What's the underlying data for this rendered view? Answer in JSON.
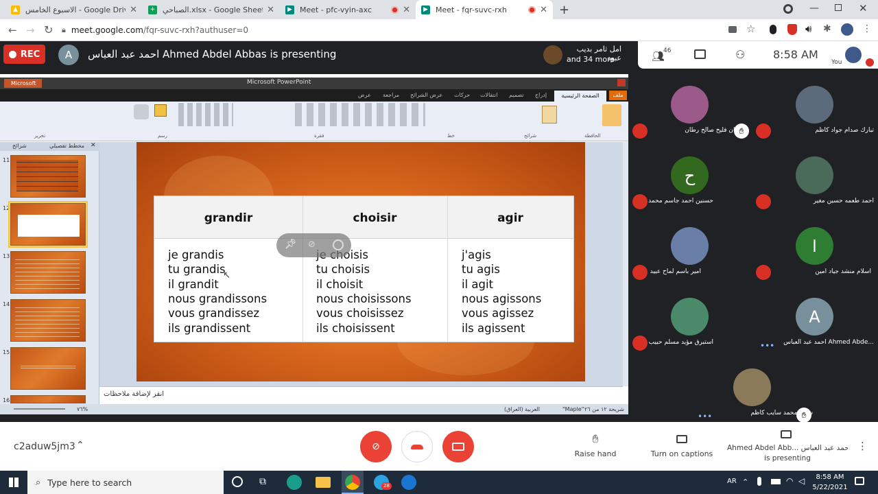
{
  "browser": {
    "tabs": [
      {
        "title": "الاسبوع الخامس - Google Drive",
        "color": "#fbbc04"
      },
      {
        "title": "الصباحي.xlsx - Google Sheets",
        "color": "#0f9d58"
      },
      {
        "title": "Meet - pfc-vyin-axc",
        "color": "#00897b"
      },
      {
        "title": "Meet - fqr-suvc-rxh",
        "color": "#00897b"
      }
    ],
    "new_tab": "+",
    "url_domain": "meet.google.com",
    "url_path": "/fqr-suvc-rxh?authuser=0"
  },
  "meet_top": {
    "rec_label": "REC",
    "presenter_avatar_letter": "A",
    "presenting_text": "احمد عبد العباس Ahmed Abdel Abbas is presenting",
    "others_name": "امل ثامر بديب عبود",
    "others_more": "and 34 more",
    "participant_count": "46",
    "time": "8:58 AM",
    "you_label": "You"
  },
  "powerpoint": {
    "app_title": "Microsoft PowerPoint",
    "window_label": "Microsoft Po",
    "ribbon_tabs": [
      "ملف",
      "الصفحة الرئيسية",
      "إدراج",
      "تصميم",
      "انتقالات",
      "حركات",
      "عرض الشرائح",
      "مراجعة",
      "عرض"
    ],
    "group_labels": [
      "الحافظة",
      "شرائح",
      "خط",
      "فقرة",
      "رسم",
      "تحرير"
    ],
    "panel_tabs": [
      "شرائح",
      "مخطط تفصيلي"
    ],
    "thumb_numbers": [
      "11",
      "12",
      "13",
      "14",
      "15",
      "16"
    ],
    "notes_placeholder": "انقر لإضافة ملاحظات",
    "status_slide": "شريحة ١٢ من ٢٦",
    "status_theme": "\"Maple\"",
    "status_lang": "العربية (العراق)",
    "status_zoom": "٧٦%"
  },
  "slide": {
    "columns": [
      {
        "verb": "grandir",
        "forms": [
          "je grandis",
          "tu grandis",
          "il grandit",
          "nous grandissons",
          "vous grandissez",
          "ils grandissent"
        ]
      },
      {
        "verb": "choisir",
        "forms": [
          "je choisis",
          "tu choisis",
          "il choisit",
          "nous choisissons",
          "vous choisissez",
          "ils choisissent"
        ]
      },
      {
        "verb": "agir",
        "forms": [
          "j'agis",
          "tu agis",
          "il agit",
          "nous agissons",
          "vous agissez",
          "ils agissent"
        ]
      }
    ]
  },
  "participants": [
    {
      "name": "تبارك صدام جواد كاظم",
      "muted": true,
      "avatar": "photo",
      "color": "#5b6b7b"
    },
    {
      "name": "ايمان فليح صالح رطان",
      "muted": true,
      "avatar": "photo",
      "color": "#9b5a8a",
      "hand": true
    },
    {
      "name": "احمد طعمه حسين مغير",
      "muted": true,
      "avatar": "photo",
      "color": "#4a6a5a"
    },
    {
      "name": "حسنين احمد جاسم محمد",
      "muted": true,
      "avatar": "letter",
      "letter": "ح",
      "color": "#33691e"
    },
    {
      "name": "اسلام منشد جياد امين",
      "muted": true,
      "avatar": "letter",
      "letter": "ا",
      "color": "#2e7d32"
    },
    {
      "name": "امير باسم لماح عبيد",
      "muted": true,
      "avatar": "photo",
      "color": "#6a7fa8"
    },
    {
      "name": "احمد عبد العباس Ahmed Abde...",
      "muted": false,
      "avatar": "letter",
      "letter": "A",
      "color": "#78909c"
    },
    {
      "name": "استبرق مؤيد مسلم حبيب",
      "muted": true,
      "avatar": "photo",
      "color": "#4a8a6a"
    },
    {
      "name": "سدير محمد سايب كاظم",
      "muted": false,
      "avatar": "photo",
      "color": "#8a7a5a",
      "hand": true
    }
  ],
  "bottom_bar": {
    "meeting_code": "c2aduw5jm3",
    "raise_hand": "Raise hand",
    "captions": "Turn on captions",
    "presenter_line1": "Ahmed Abdel Abb... احمد عبد العباس",
    "presenter_line2": "is presenting"
  },
  "taskbar": {
    "search_placeholder": "Type here to search",
    "lang": "AR",
    "time": "8:58 AM",
    "date": "5/22/2021",
    "badge": "28"
  }
}
